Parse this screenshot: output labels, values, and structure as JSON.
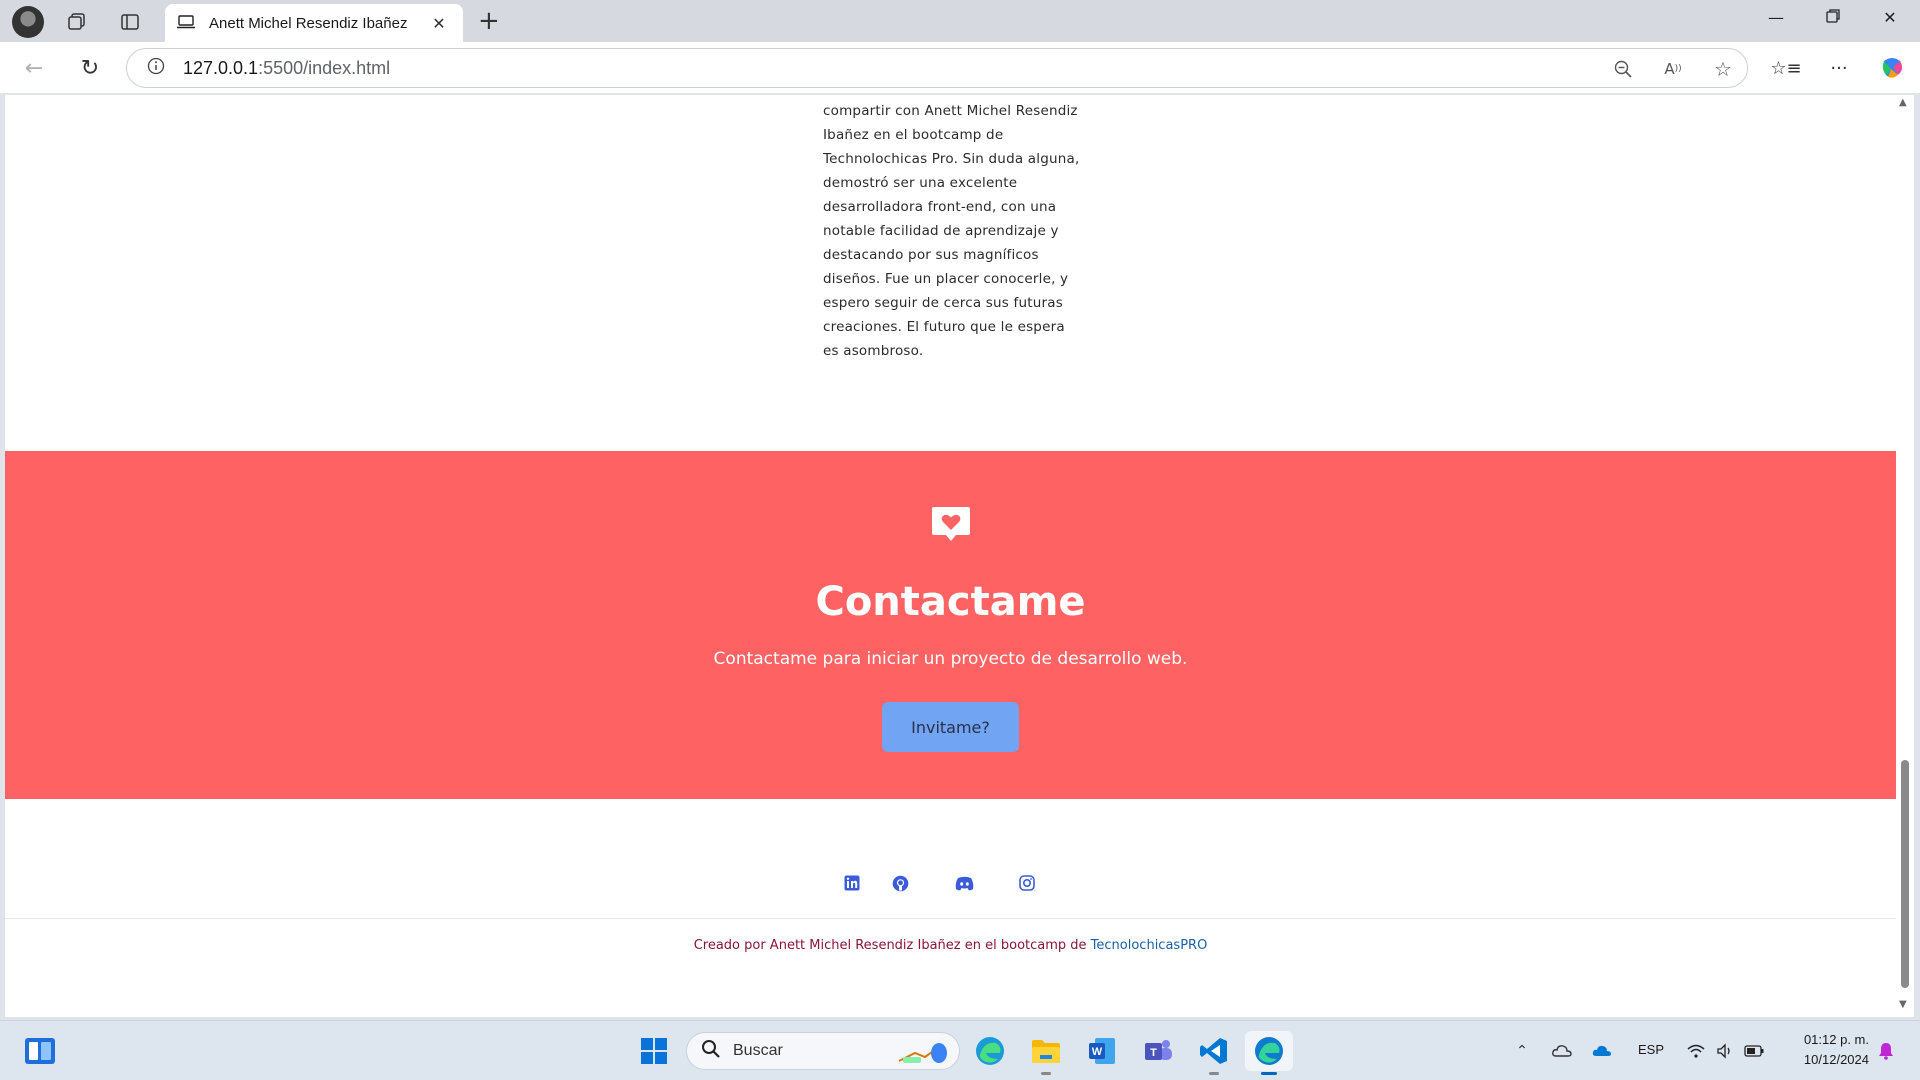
{
  "browser": {
    "tab_title": "Anett Michel Resendiz Ibañez",
    "url_host": "127.0.0.1",
    "url_rest": ":5500/index.html"
  },
  "page": {
    "testimonial_text": "compartir con Anett Michel Resendiz Ibañez en el bootcamp de Technolochicas Pro. Sin duda alguna, demostró ser una excelente desarrolladora front-end, con una notable facilidad de aprendizaje y destacando por sus magníficos diseños. Fue un placer conocerle, y espero seguir de cerca sus futuras creaciones. El futuro que le espera es asombroso.",
    "contact": {
      "title": "Contactame",
      "subtitle": "Contactame para iniciar un proyecto de desarrollo web.",
      "button_label": "Invitame?",
      "background_color": "#ff6262",
      "button_color": "#71a5f3"
    },
    "social_icons": [
      "linkedin-icon",
      "github-icon",
      "discord-icon",
      "instagram-icon"
    ],
    "footer": {
      "credit_prefix": "Creado por Anett Michel Resendiz Ibañez en el bootcamp de ",
      "credit_link": "TecnolochicasPRO"
    }
  },
  "taskbar": {
    "search_placeholder": "Buscar",
    "language": "ESP",
    "time": "01:12 p. m.",
    "date": "10/12/2024"
  }
}
